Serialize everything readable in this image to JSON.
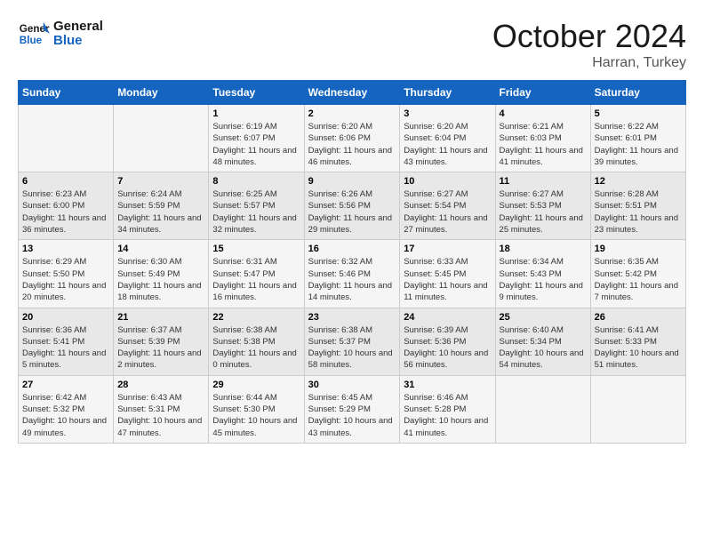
{
  "header": {
    "logo_general": "General",
    "logo_blue": "Blue",
    "month_year": "October 2024",
    "location": "Harran, Turkey"
  },
  "days_of_week": [
    "Sunday",
    "Monday",
    "Tuesday",
    "Wednesday",
    "Thursday",
    "Friday",
    "Saturday"
  ],
  "weeks": [
    [
      {
        "day": "",
        "sunrise": "",
        "sunset": "",
        "daylight": ""
      },
      {
        "day": "",
        "sunrise": "",
        "sunset": "",
        "daylight": ""
      },
      {
        "day": "1",
        "sunrise": "Sunrise: 6:19 AM",
        "sunset": "Sunset: 6:07 PM",
        "daylight": "Daylight: 11 hours and 48 minutes."
      },
      {
        "day": "2",
        "sunrise": "Sunrise: 6:20 AM",
        "sunset": "Sunset: 6:06 PM",
        "daylight": "Daylight: 11 hours and 46 minutes."
      },
      {
        "day": "3",
        "sunrise": "Sunrise: 6:20 AM",
        "sunset": "Sunset: 6:04 PM",
        "daylight": "Daylight: 11 hours and 43 minutes."
      },
      {
        "day": "4",
        "sunrise": "Sunrise: 6:21 AM",
        "sunset": "Sunset: 6:03 PM",
        "daylight": "Daylight: 11 hours and 41 minutes."
      },
      {
        "day": "5",
        "sunrise": "Sunrise: 6:22 AM",
        "sunset": "Sunset: 6:01 PM",
        "daylight": "Daylight: 11 hours and 39 minutes."
      }
    ],
    [
      {
        "day": "6",
        "sunrise": "Sunrise: 6:23 AM",
        "sunset": "Sunset: 6:00 PM",
        "daylight": "Daylight: 11 hours and 36 minutes."
      },
      {
        "day": "7",
        "sunrise": "Sunrise: 6:24 AM",
        "sunset": "Sunset: 5:59 PM",
        "daylight": "Daylight: 11 hours and 34 minutes."
      },
      {
        "day": "8",
        "sunrise": "Sunrise: 6:25 AM",
        "sunset": "Sunset: 5:57 PM",
        "daylight": "Daylight: 11 hours and 32 minutes."
      },
      {
        "day": "9",
        "sunrise": "Sunrise: 6:26 AM",
        "sunset": "Sunset: 5:56 PM",
        "daylight": "Daylight: 11 hours and 29 minutes."
      },
      {
        "day": "10",
        "sunrise": "Sunrise: 6:27 AM",
        "sunset": "Sunset: 5:54 PM",
        "daylight": "Daylight: 11 hours and 27 minutes."
      },
      {
        "day": "11",
        "sunrise": "Sunrise: 6:27 AM",
        "sunset": "Sunset: 5:53 PM",
        "daylight": "Daylight: 11 hours and 25 minutes."
      },
      {
        "day": "12",
        "sunrise": "Sunrise: 6:28 AM",
        "sunset": "Sunset: 5:51 PM",
        "daylight": "Daylight: 11 hours and 23 minutes."
      }
    ],
    [
      {
        "day": "13",
        "sunrise": "Sunrise: 6:29 AM",
        "sunset": "Sunset: 5:50 PM",
        "daylight": "Daylight: 11 hours and 20 minutes."
      },
      {
        "day": "14",
        "sunrise": "Sunrise: 6:30 AM",
        "sunset": "Sunset: 5:49 PM",
        "daylight": "Daylight: 11 hours and 18 minutes."
      },
      {
        "day": "15",
        "sunrise": "Sunrise: 6:31 AM",
        "sunset": "Sunset: 5:47 PM",
        "daylight": "Daylight: 11 hours and 16 minutes."
      },
      {
        "day": "16",
        "sunrise": "Sunrise: 6:32 AM",
        "sunset": "Sunset: 5:46 PM",
        "daylight": "Daylight: 11 hours and 14 minutes."
      },
      {
        "day": "17",
        "sunrise": "Sunrise: 6:33 AM",
        "sunset": "Sunset: 5:45 PM",
        "daylight": "Daylight: 11 hours and 11 minutes."
      },
      {
        "day": "18",
        "sunrise": "Sunrise: 6:34 AM",
        "sunset": "Sunset: 5:43 PM",
        "daylight": "Daylight: 11 hours and 9 minutes."
      },
      {
        "day": "19",
        "sunrise": "Sunrise: 6:35 AM",
        "sunset": "Sunset: 5:42 PM",
        "daylight": "Daylight: 11 hours and 7 minutes."
      }
    ],
    [
      {
        "day": "20",
        "sunrise": "Sunrise: 6:36 AM",
        "sunset": "Sunset: 5:41 PM",
        "daylight": "Daylight: 11 hours and 5 minutes."
      },
      {
        "day": "21",
        "sunrise": "Sunrise: 6:37 AM",
        "sunset": "Sunset: 5:39 PM",
        "daylight": "Daylight: 11 hours and 2 minutes."
      },
      {
        "day": "22",
        "sunrise": "Sunrise: 6:38 AM",
        "sunset": "Sunset: 5:38 PM",
        "daylight": "Daylight: 11 hours and 0 minutes."
      },
      {
        "day": "23",
        "sunrise": "Sunrise: 6:38 AM",
        "sunset": "Sunset: 5:37 PM",
        "daylight": "Daylight: 10 hours and 58 minutes."
      },
      {
        "day": "24",
        "sunrise": "Sunrise: 6:39 AM",
        "sunset": "Sunset: 5:36 PM",
        "daylight": "Daylight: 10 hours and 56 minutes."
      },
      {
        "day": "25",
        "sunrise": "Sunrise: 6:40 AM",
        "sunset": "Sunset: 5:34 PM",
        "daylight": "Daylight: 10 hours and 54 minutes."
      },
      {
        "day": "26",
        "sunrise": "Sunrise: 6:41 AM",
        "sunset": "Sunset: 5:33 PM",
        "daylight": "Daylight: 10 hours and 51 minutes."
      }
    ],
    [
      {
        "day": "27",
        "sunrise": "Sunrise: 6:42 AM",
        "sunset": "Sunset: 5:32 PM",
        "daylight": "Daylight: 10 hours and 49 minutes."
      },
      {
        "day": "28",
        "sunrise": "Sunrise: 6:43 AM",
        "sunset": "Sunset: 5:31 PM",
        "daylight": "Daylight: 10 hours and 47 minutes."
      },
      {
        "day": "29",
        "sunrise": "Sunrise: 6:44 AM",
        "sunset": "Sunset: 5:30 PM",
        "daylight": "Daylight: 10 hours and 45 minutes."
      },
      {
        "day": "30",
        "sunrise": "Sunrise: 6:45 AM",
        "sunset": "Sunset: 5:29 PM",
        "daylight": "Daylight: 10 hours and 43 minutes."
      },
      {
        "day": "31",
        "sunrise": "Sunrise: 6:46 AM",
        "sunset": "Sunset: 5:28 PM",
        "daylight": "Daylight: 10 hours and 41 minutes."
      },
      {
        "day": "",
        "sunrise": "",
        "sunset": "",
        "daylight": ""
      },
      {
        "day": "",
        "sunrise": "",
        "sunset": "",
        "daylight": ""
      }
    ]
  ]
}
